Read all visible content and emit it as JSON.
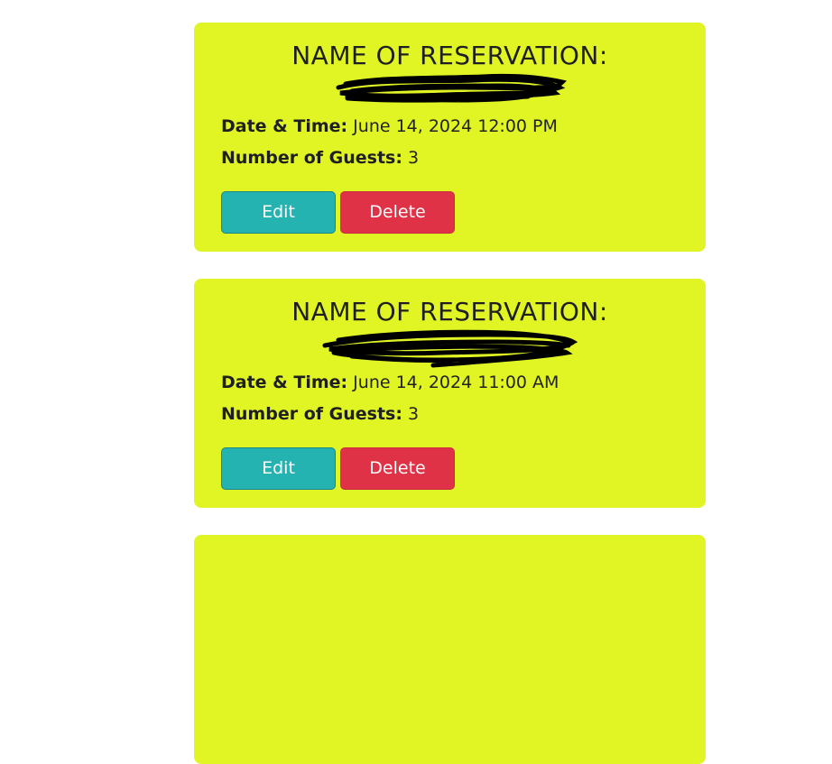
{
  "reservations": [
    {
      "title": "NAME OF RESERVATION:",
      "date_label": "Date & Time:",
      "date_value": "June 14, 2024 12:00 PM",
      "guests_label": "Number of Guests:",
      "guests_value": "3",
      "edit_label": "Edit",
      "delete_label": "Delete"
    },
    {
      "title": "NAME OF RESERVATION:",
      "date_label": "Date & Time:",
      "date_value": "June 14, 2024 11:00 AM",
      "guests_label": "Number of Guests:",
      "guests_value": "3",
      "edit_label": "Edit",
      "delete_label": "Delete"
    }
  ],
  "colors": {
    "card_background": "#e1f524",
    "edit_button": "#24b3b0",
    "delete_button": "#e03247",
    "redaction": "#000000"
  }
}
